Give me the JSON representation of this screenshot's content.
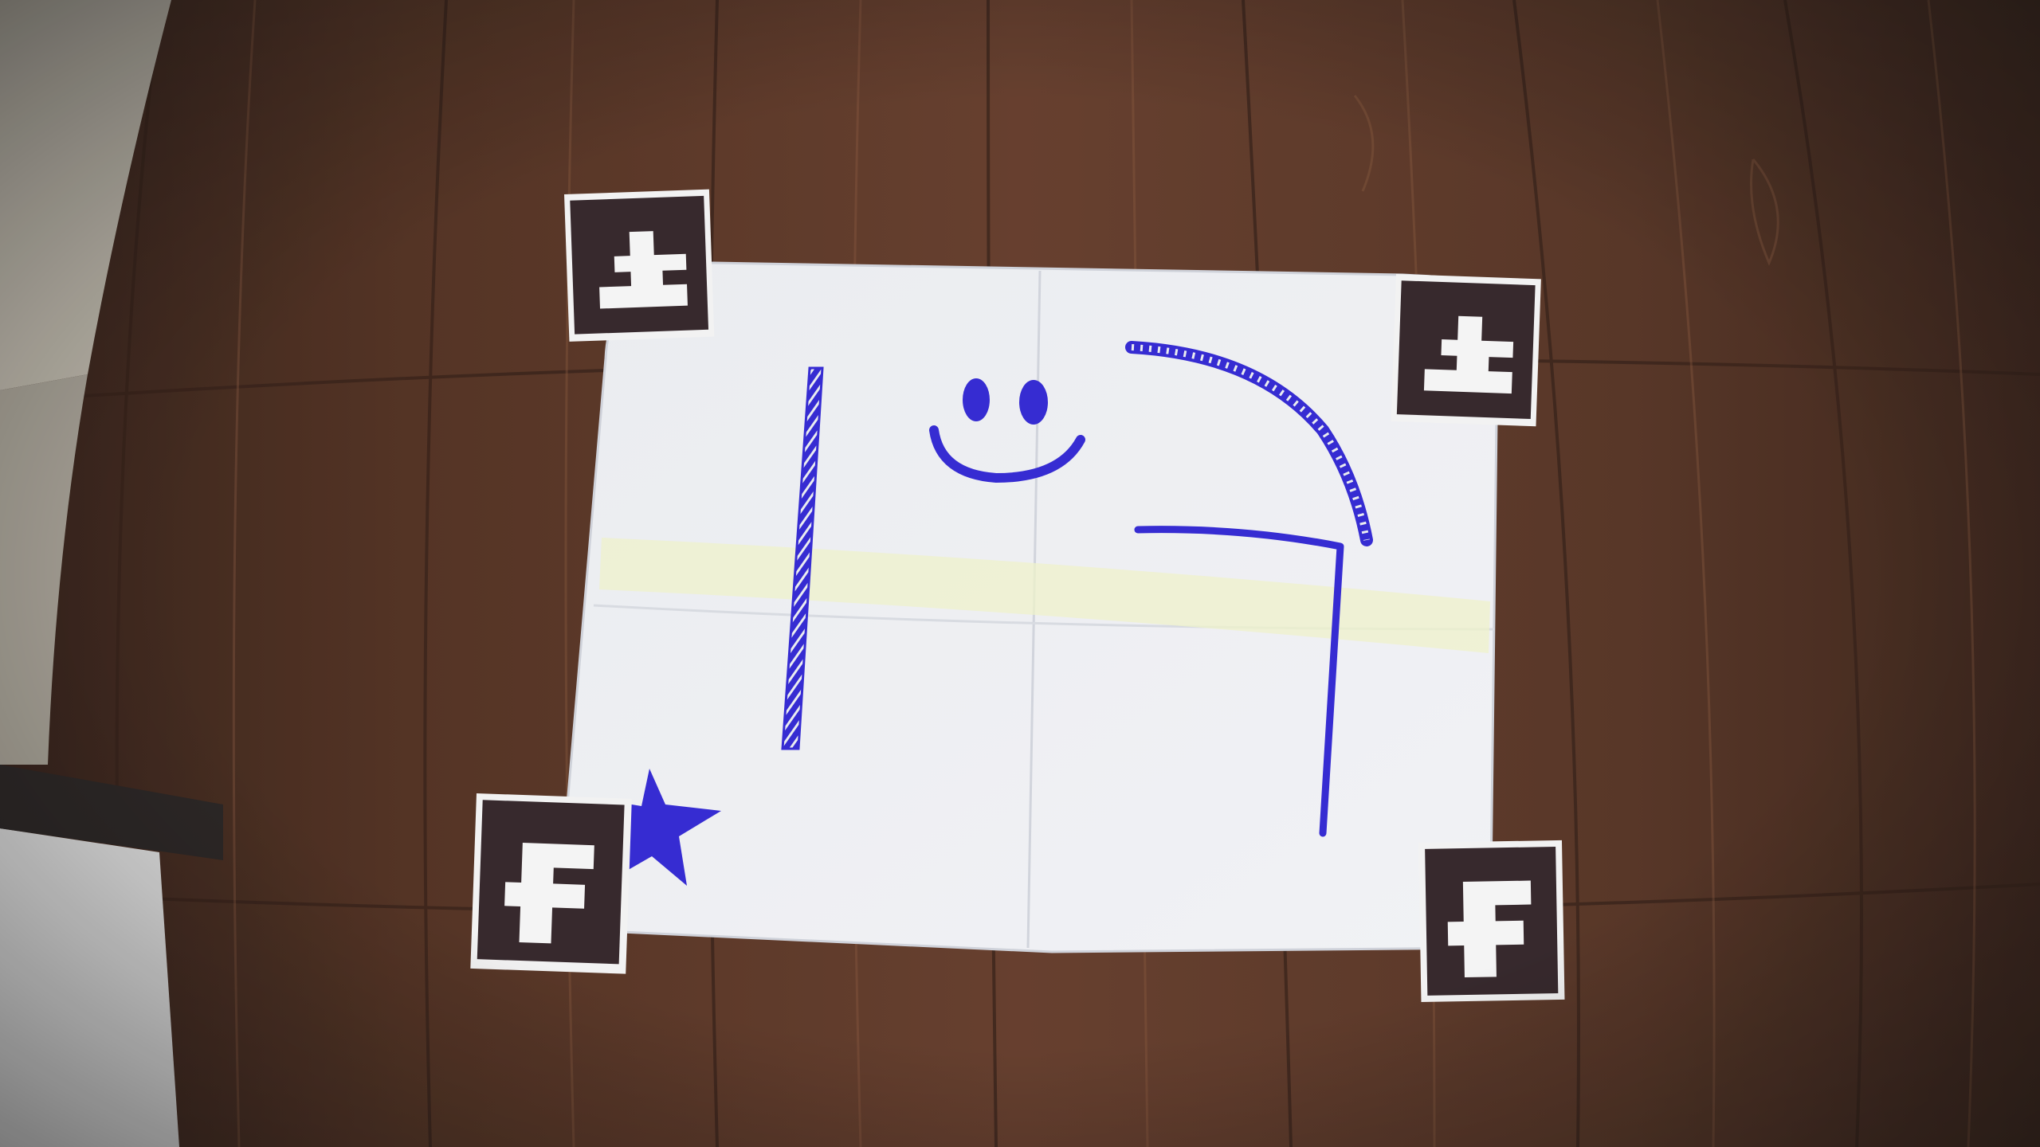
{
  "photo": {
    "subject": "",
    "colors": {
      "floor_dark": "#3b2015",
      "floor_mid": "#5a3322",
      "floor_light": "#7a4a32",
      "tile": "#c9c2b4",
      "paper": "#eceef2",
      "paper_shadow": "#d8dbe2",
      "tape": "#e8edc8",
      "ink_blue": "#2a1fd0",
      "marker_black": "#2a1c1f",
      "marker_white": "#f4f4f4"
    },
    "fiducial_markers": [
      {
        "name": "marker-top-left",
        "glyph": "cross-offset"
      },
      {
        "name": "marker-top-right",
        "glyph": "cross-offset"
      },
      {
        "name": "marker-bottom-left",
        "glyph": "f-shape"
      },
      {
        "name": "marker-bottom-right",
        "glyph": "f-shape"
      }
    ],
    "drawings": [
      {
        "name": "vertical-hatched-line",
        "color": "ink_blue"
      },
      {
        "name": "smiley-face",
        "color": "ink_blue"
      },
      {
        "name": "curved-hatched-line",
        "color": "ink_blue"
      },
      {
        "name": "right-angle-line",
        "color": "ink_blue"
      },
      {
        "name": "star",
        "color": "ink_blue"
      }
    ]
  }
}
